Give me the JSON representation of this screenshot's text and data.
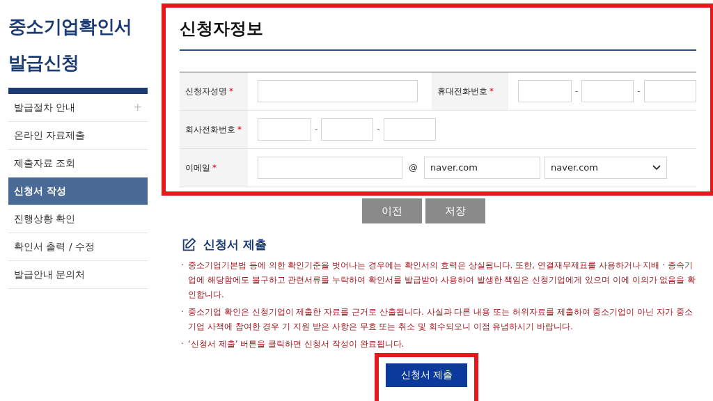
{
  "sidebar": {
    "title_lines": [
      "중소기업확인서",
      "발급신청"
    ],
    "items": [
      {
        "label": "발급절차 안내",
        "selected": false,
        "expand_glyph": "+"
      },
      {
        "label": "온라인 자료제출",
        "selected": false
      },
      {
        "label": "제출자료 조회",
        "selected": false
      },
      {
        "label": "신청서 작성",
        "selected": true
      },
      {
        "label": "진행상황 확인",
        "selected": false
      },
      {
        "label": "확인서 출력 / 수정",
        "selected": false
      },
      {
        "label": "발급안내 문의처",
        "selected": false
      }
    ]
  },
  "applicant_form": {
    "title": "신청자정보",
    "rows": [
      {
        "groups": [
          {
            "label": "신청자성명",
            "mark": "*",
            "kind": "text"
          },
          {
            "label": "휴대전화번호",
            "mark": "*",
            "kind": "phone",
            "separators": [
              "-",
              "-"
            ]
          }
        ]
      },
      {
        "groups": [
          {
            "label": "회사전화번호",
            "mark": "*",
            "kind": "phone",
            "separators": [
              "-",
              "-"
            ]
          }
        ]
      },
      {
        "groups": [
          {
            "label": "이메일",
            "mark": "*",
            "kind": "email",
            "at": "@",
            "domain": "naver.com",
            "domain_select": "naver.com"
          }
        ]
      }
    ]
  },
  "form_buttons": [
    "이전",
    "저장"
  ],
  "submission": {
    "title": "신청서 제출",
    "notes": [
      {
        "bullet": "·",
        "text": "중소기업기본법 등에 의한 확인기준을 벗어나는 경우에는 확인서의 효력은 상실됩니다. 또한, 연결재무제표를 사용하거나 지배 · 종속기업에 해당함에도 불구하고 관련서류를 누락하여 확인서를 발급받아 사용하여 발생한 책임은 신청기업에게 있으며 이에 이의가 없음을 확인합니다."
      },
      {
        "bullet": "·",
        "text": "중소기업 확인은 신청기업이 제출한 자료를 근거로 산출됩니다. 사실과 다른 내용 또는 허위자료를 제출하여 중소기업이 아닌 자가 중소기업 사책에 참여한 경우 기 지원 받은 사항은 무효 또는 취소 및 회수되오니 이점 유념하시기 바랍니다."
      },
      {
        "bullet": "·",
        "text": "‘신청서 제출’ 버튼을 클릭하면 신청서 작성이 완료됩니다."
      }
    ],
    "submit_button": "신청서 제출"
  }
}
